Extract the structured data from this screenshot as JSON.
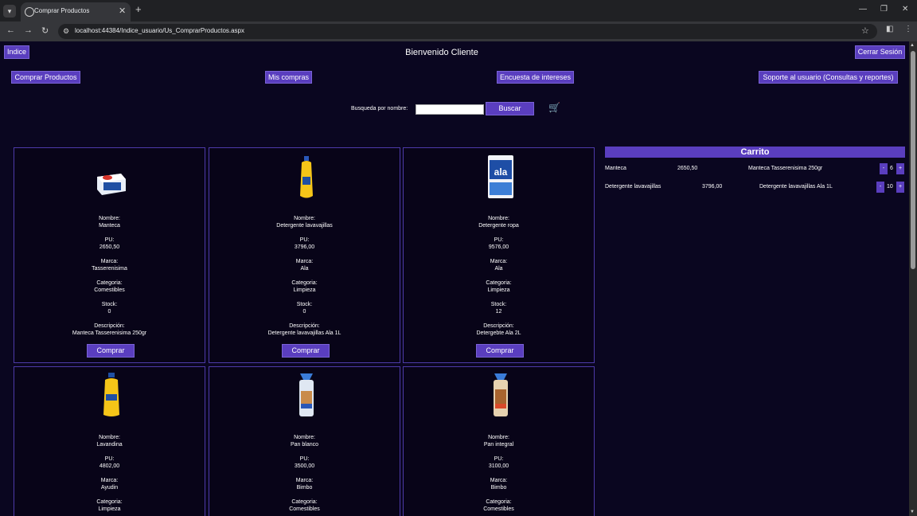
{
  "browser": {
    "tab_title": "Comprar Productos",
    "url": "localhost:44384/Indice_usuario/Us_ComprarProductos.aspx",
    "icons": [
      "tab-search-icon",
      "close-icon",
      "new-tab-icon",
      "minimize-icon",
      "restore-icon",
      "window-close-icon",
      "back-icon",
      "forward-icon",
      "reload-icon",
      "site-info-icon",
      "bookmark-star-icon",
      "extensions-icon",
      "menu-dots-icon"
    ]
  },
  "header": {
    "indice": "Indice",
    "welcome": "Bienvenido Cliente",
    "logout": "Cerrar Sesión"
  },
  "nav": {
    "comprar": "Comprar Productos",
    "mis_compras": "Mis compras",
    "encuesta": "Encuesta de intereses",
    "soporte": "Soporte al usuario (Consultas y reportes)"
  },
  "search": {
    "label": "Busqueda por nombre:",
    "value": "",
    "button": "Buscar"
  },
  "labels": {
    "nombre": "Nombre:",
    "pu": "PU:",
    "marca": "Marca:",
    "categoria": "Categoria:",
    "stock": "Stock:",
    "descripcion": "Descripción:",
    "comprar": "Comprar"
  },
  "products": [
    {
      "nombre": "Manteca",
      "pu": "2650,50",
      "marca": "Tasserenisima",
      "categoria": "Comestibles",
      "stock": "0",
      "descripcion": "Manteca Tasserenisima 250gr"
    },
    {
      "nombre": "Detergente lavavajillas",
      "pu": "3796,00",
      "marca": "Ala",
      "categoria": "Limpieza",
      "stock": "0",
      "descripcion": "Detergente lavavajillas Ala 1L"
    },
    {
      "nombre": "Detergente ropa",
      "pu": "9576,00",
      "marca": "Ala",
      "categoria": "Limpieza",
      "stock": "12",
      "descripcion": "Detergebte Ala 2L"
    },
    {
      "nombre": "Lavandina",
      "pu": "4802,00",
      "marca": "Ayudin",
      "categoria": "Limpieza",
      "stock": "",
      "descripcion": ""
    },
    {
      "nombre": "Pan blanco",
      "pu": "3500,00",
      "marca": "Bimbo",
      "categoria": "Comestibles",
      "stock": "",
      "descripcion": ""
    },
    {
      "nombre": "Pan integral",
      "pu": "3100,00",
      "marca": "Bimbo",
      "categoria": "Comestibles",
      "stock": "",
      "descripcion": ""
    }
  ],
  "cart": {
    "title": "Carrito",
    "items": [
      {
        "nombre": "Manteca",
        "pu": "2650,50",
        "descripcion": "Manteca Tasserenisima 250gr",
        "qty": "6"
      },
      {
        "nombre": "Detergente lavavajillas",
        "pu": "3796,00",
        "descripcion": "Detergente lavavajillas Ala 1L",
        "qty": "10"
      }
    ],
    "minus": "-",
    "plus": "+"
  },
  "colors": {
    "accent": "#5a3ebf",
    "page_bg": "#0a0620",
    "card_border": "#4d3aa8"
  }
}
